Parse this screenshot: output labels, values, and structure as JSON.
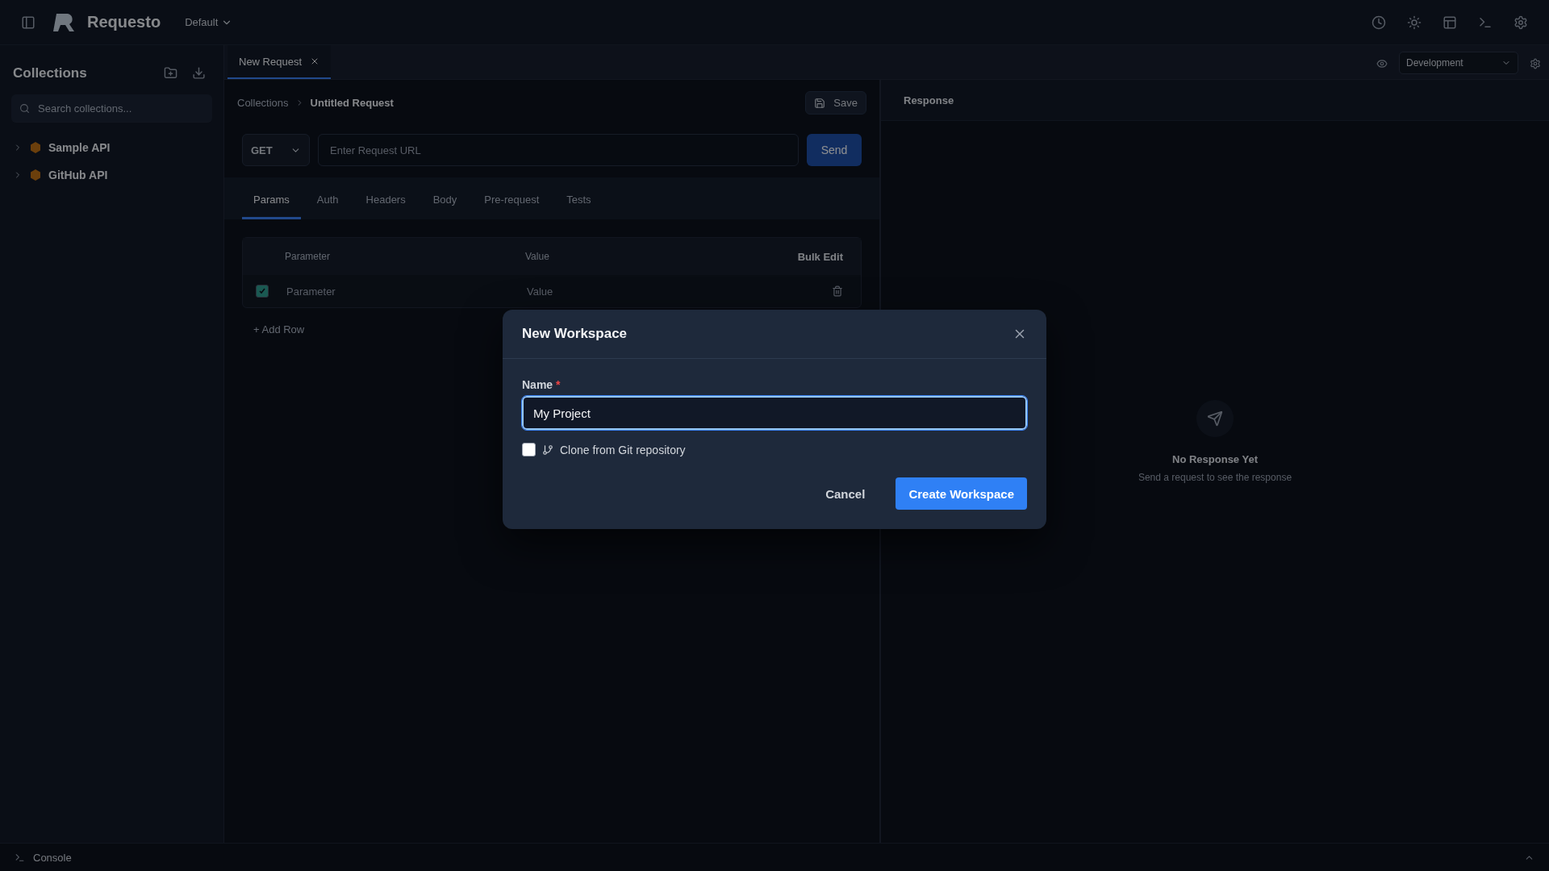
{
  "app": {
    "name": "Requesto",
    "workspace": "Default"
  },
  "sidebar": {
    "title": "Collections",
    "search_placeholder": "Search collections...",
    "collections": [
      {
        "name": "Sample API"
      },
      {
        "name": "GitHub API"
      }
    ]
  },
  "tabs": [
    {
      "label": "New Request",
      "selected": true
    }
  ],
  "environment": "Development",
  "request": {
    "breadcrumb": [
      "Collections",
      "Untitled Request"
    ],
    "save": "Save",
    "method": "GET",
    "url_placeholder": "Enter Request URL",
    "send": "Send",
    "tabs": [
      {
        "label": "Params",
        "selected": true
      },
      {
        "label": "Auth",
        "selected": false
      },
      {
        "label": "Headers",
        "selected": false
      },
      {
        "label": "Body",
        "selected": false
      },
      {
        "label": "Pre-request",
        "selected": false
      },
      {
        "label": "Tests",
        "selected": false
      }
    ],
    "params": {
      "columns": [
        "Parameter",
        "Value"
      ],
      "bulk_edit": "Bulk Edit",
      "rows": [
        {
          "checked": true,
          "key_placeholder": "Parameter",
          "value_placeholder": "Value"
        }
      ],
      "add_row": "+ Add Row"
    }
  },
  "response": {
    "title": "Response",
    "empty_title": "No Response Yet",
    "empty_hint": "Send a request to see the response"
  },
  "console": {
    "label": "Console"
  },
  "dialog": {
    "title": "New Workspace",
    "field_label": "Name",
    "required_mark": "*",
    "value": "My Project",
    "clone_label": "Clone from Git repository",
    "clone_checked": false,
    "buttons": [
      {
        "label": "Cancel",
        "kind": "secondary"
      },
      {
        "label": "Create Workspace",
        "kind": "primary"
      }
    ]
  }
}
